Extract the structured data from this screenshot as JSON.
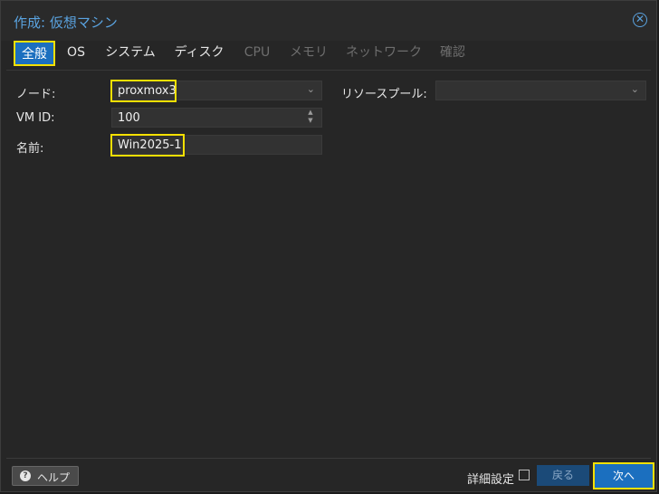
{
  "window": {
    "title": "作成: 仮想マシン"
  },
  "tabs": [
    {
      "label": "全般",
      "state": "active"
    },
    {
      "label": "OS",
      "state": "enabled"
    },
    {
      "label": "システム",
      "state": "enabled"
    },
    {
      "label": "ディスク",
      "state": "enabled"
    },
    {
      "label": "CPU",
      "state": "disabled"
    },
    {
      "label": "メモリ",
      "state": "disabled"
    },
    {
      "label": "ネットワーク",
      "state": "disabled"
    },
    {
      "label": "確認",
      "state": "disabled"
    }
  ],
  "form": {
    "node_label": "ノード:",
    "node_value": "proxmox3",
    "vmid_label": "VM ID:",
    "vmid_value": "100",
    "name_label": "名前:",
    "name_value": "Win2025-1",
    "pool_label": "リソースプール:",
    "pool_value": ""
  },
  "footer": {
    "help_label": "ヘルプ",
    "advanced_label": "詳細設定",
    "advanced_checked": false,
    "back_label": "戻る",
    "next_label": "次へ"
  },
  "colors": {
    "accent": "#1b6fbf",
    "title": "#5aa3e0",
    "highlight": "#f5e000",
    "background": "#262626"
  },
  "icons": {
    "close": "close-circle-icon",
    "help": "question-circle-icon",
    "dropdown": "chevron-down-icon",
    "spinner": "spinner-arrows-icon"
  }
}
